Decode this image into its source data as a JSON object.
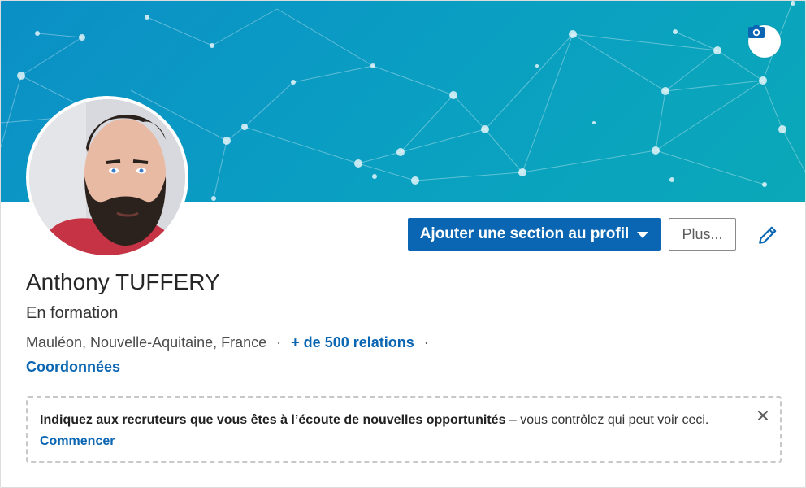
{
  "profile": {
    "name": "Anthony TUFFERY",
    "headline": "En formation",
    "location": "Mauléon, Nouvelle-Aquitaine, France",
    "separator": "·",
    "connections": "+ de 500 relations",
    "contact_info": "Coordonnées"
  },
  "actions": {
    "add_section_label": "Ajouter une section au profil",
    "more_label": "Plus..."
  },
  "notice": {
    "bold_text": "Indiquez aux recruteurs que vous êtes à l’écoute de nouvelles opportunités",
    "rest_text": " – vous contrôlez qui peut voir ceci.",
    "cta": "Commencer"
  },
  "icons": {
    "camera": "camera-icon",
    "pencil": "pencil-icon",
    "close": "close-icon",
    "dropdown": "caret-down-icon"
  },
  "colors": {
    "brand_blue": "#0a66b2",
    "banner_start": "#0b8fc6",
    "banner_end": "#0aa8b8"
  }
}
